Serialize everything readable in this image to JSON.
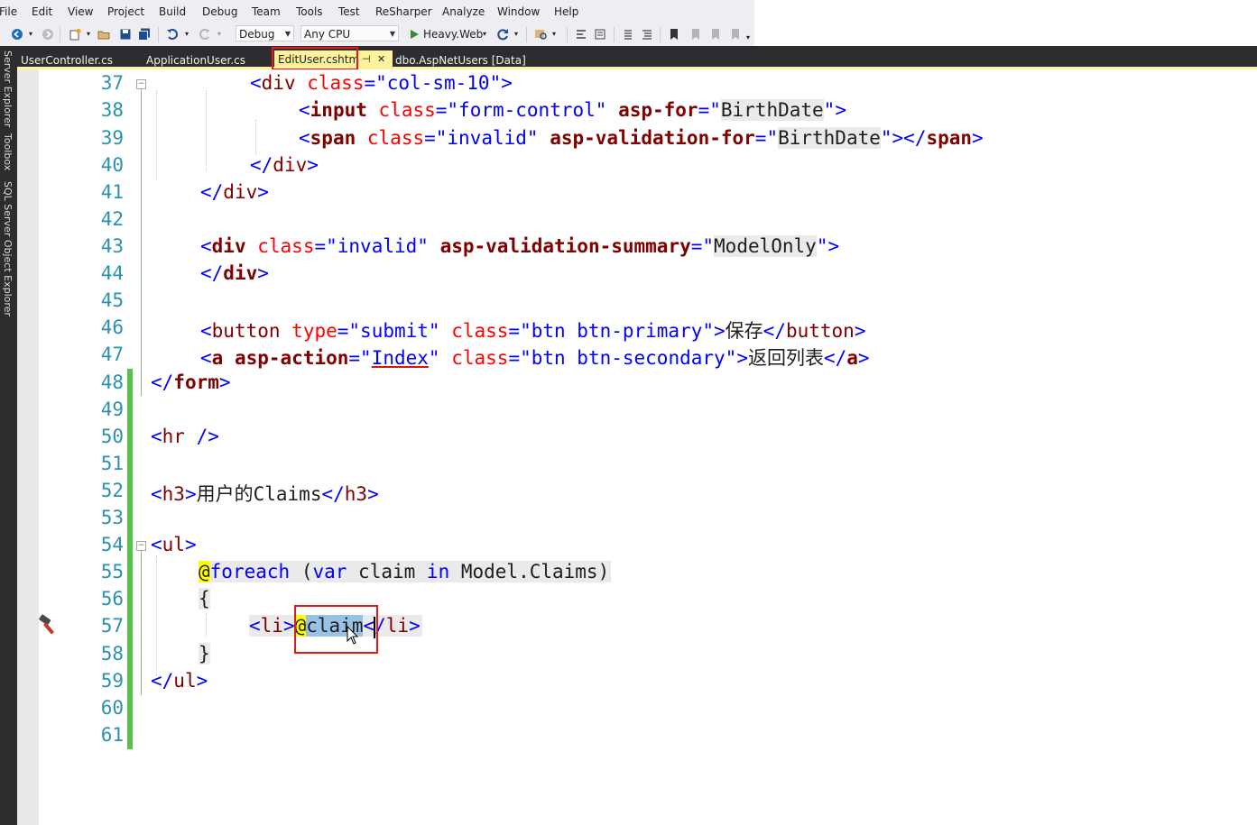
{
  "menu": [
    "File",
    "Edit",
    "View",
    "Project",
    "Build",
    "Debug",
    "Team",
    "Tools",
    "Test",
    "ReSharper",
    "Analyze",
    "Window",
    "Help"
  ],
  "toolbar": {
    "config": "Debug",
    "platform": "Any CPU",
    "run_target": "Heavy.Web"
  },
  "tabs": [
    {
      "label": "UserController.cs"
    },
    {
      "label": "ApplicationUser.cs"
    },
    {
      "label": "EditUser.cshtml"
    },
    {
      "label": "dbo.AspNetUsers [Data]"
    }
  ],
  "tab_pin": "⊣",
  "tab_close": "✕",
  "side_panels": [
    "Server Explorer",
    "Toolbox",
    "SQL Server Object Explorer"
  ],
  "lines": [
    "37",
    "38",
    "39",
    "40",
    "41",
    "42",
    "43",
    "44",
    "45",
    "46",
    "47",
    "48",
    "49",
    "50",
    "51",
    "52",
    "53",
    "54",
    "55",
    "56",
    "57",
    "58",
    "59",
    "60",
    "61"
  ],
  "code": {
    "l37": {
      "o": "<",
      "tag": "div",
      "sp": " ",
      "attr": "class",
      "eq": "=\"",
      "val": "col-sm-10",
      "close": "\">"
    },
    "l38": {
      "o": "<",
      "tag": "input",
      "sp": " ",
      "attr1": "class",
      "eq1": "=\"",
      "val1": "form-control",
      "q1": "\" ",
      "attr2": "asp-for",
      "eq2": "=\"",
      "val2": "BirthDate",
      "close": "\">"
    },
    "l39": {
      "o": "<",
      "tag": "span",
      "sp": " ",
      "attr1": "class",
      "eq1": "=\"",
      "val1": "invalid",
      "q1": "\" ",
      "attr2": "asp-validation-for",
      "eq2": "=\"",
      "val2": "BirthDate",
      "close": "\"></",
      "tag2": "span",
      "end": ">"
    },
    "l40": {
      "o": "</",
      "tag": "div",
      "end": ">"
    },
    "l41": {
      "o": "</",
      "tag": "div",
      "end": ">"
    },
    "l43": {
      "o": "<",
      "tag": "div",
      "sp": " ",
      "attr1": "class",
      "eq1": "=\"",
      "val1": "invalid",
      "q1": "\" ",
      "attr2": "asp-validation-summary",
      "eq2": "=\"",
      "val2": "ModelOnly",
      "close": "\">"
    },
    "l44": {
      "o": "</",
      "tag": "div",
      "end": ">"
    },
    "l46": {
      "o": "<",
      "tag": "button",
      "sp": " ",
      "attr1": "type",
      "eq1": "=\"",
      "val1": "submit",
      "q1": "\" ",
      "attr2": "class",
      "eq2": "=\"",
      "val2": "btn btn-primary",
      "close": "\">",
      "text": "保存",
      "o2": "</",
      "tag2": "button",
      "end": ">"
    },
    "l47": {
      "o": "<",
      "tag": "a",
      "sp": " ",
      "attr1": "asp-action",
      "eq1": "=\"",
      "val1": "Index",
      "q1": "\" ",
      "attr2": "class",
      "eq2": "=\"",
      "val2": "btn btn-secondary",
      "close": "\">",
      "text": "返回列表",
      "o2": "</",
      "tag2": "a",
      "end": ">"
    },
    "l48": {
      "o": "</",
      "tag": "form",
      "end": ">"
    },
    "l50": {
      "o": "<",
      "tag": "hr",
      "end": " />"
    },
    "l52": {
      "o": "<",
      "tag": "h3",
      "close": ">",
      "text": "用户的Claims",
      "o2": "</",
      "tag2": "h3",
      "end": ">"
    },
    "l54": {
      "o": "<",
      "tag": "ul",
      "end": ">"
    },
    "l55": {
      "at": "@",
      "kw1": "foreach",
      "p1": " (",
      "kw2": "var",
      "mid": " claim ",
      "kw3": "in",
      "rest": " Model.Claims)"
    },
    "l56": {
      "text": "{"
    },
    "l57": {
      "o": "<",
      "tag": "li",
      "c1": ">",
      "at": "@",
      "sel": "claim",
      "o2": "</",
      "tag2": "li",
      "end": ">"
    },
    "l58": {
      "text": "}"
    },
    "l59": {
      "o": "</",
      "tag": "ul",
      "end": ">"
    }
  },
  "colors": {
    "tag": "#800000",
    "attr": "#ff0000",
    "punct": "#0000ff",
    "linenum": "#2b91af",
    "changebar": "#57c248",
    "active_tab": "#fff29d",
    "highlight": "#e21a1a"
  },
  "icons": {
    "back": "back-arrow-icon",
    "forward": "forward-arrow-icon",
    "new_project": "new-project-icon",
    "open": "open-folder-icon",
    "save": "save-icon",
    "save_all": "save-all-icon",
    "undo": "undo-icon",
    "redo": "redo-icon",
    "run": "play-icon",
    "refresh": "refresh-icon",
    "quick_action": "hammer-icon"
  }
}
